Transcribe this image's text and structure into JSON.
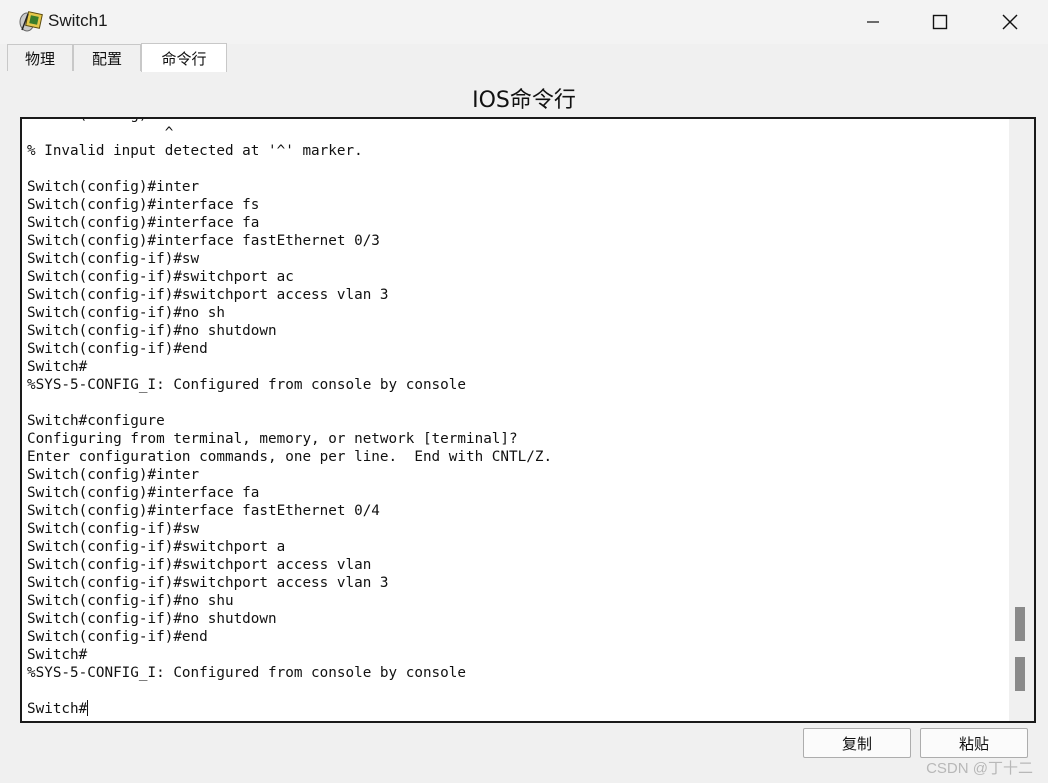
{
  "window": {
    "title": "Switch1",
    "icon": "switch-device-icon"
  },
  "tabs": [
    {
      "label": "物理",
      "active": false
    },
    {
      "label": "配置",
      "active": false
    },
    {
      "label": "命令行",
      "active": true
    }
  ],
  "heading": "IOS命令行",
  "console": {
    "lines": [
      "Switch(config)#sho vlan",
      "                ^",
      "% Invalid input detected at '^' marker.",
      "",
      "Switch(config)#inter",
      "Switch(config)#interface fs",
      "Switch(config)#interface fa",
      "Switch(config)#interface fastEthernet 0/3",
      "Switch(config-if)#sw",
      "Switch(config-if)#switchport ac",
      "Switch(config-if)#switchport access vlan 3",
      "Switch(config-if)#no sh",
      "Switch(config-if)#no shutdown",
      "Switch(config-if)#end",
      "Switch#",
      "%SYS-5-CONFIG_I: Configured from console by console",
      "",
      "Switch#configure",
      "Configuring from terminal, memory, or network [terminal]?",
      "Enter configuration commands, one per line.  End with CNTL/Z.",
      "Switch(config)#inter",
      "Switch(config)#interface fa",
      "Switch(config)#interface fastEthernet 0/4",
      "Switch(config-if)#sw",
      "Switch(config-if)#switchport a",
      "Switch(config-if)#switchport access vlan",
      "Switch(config-if)#switchport access vlan 3",
      "Switch(config-if)#no shu",
      "Switch(config-if)#no shutdown",
      "Switch(config-if)#end",
      "Switch#",
      "%SYS-5-CONFIG_I: Configured from console by console",
      ""
    ],
    "prompt": "Switch#"
  },
  "buttons": {
    "copy": "复制",
    "paste": "粘贴"
  },
  "watermark": "CSDN @丁十二"
}
